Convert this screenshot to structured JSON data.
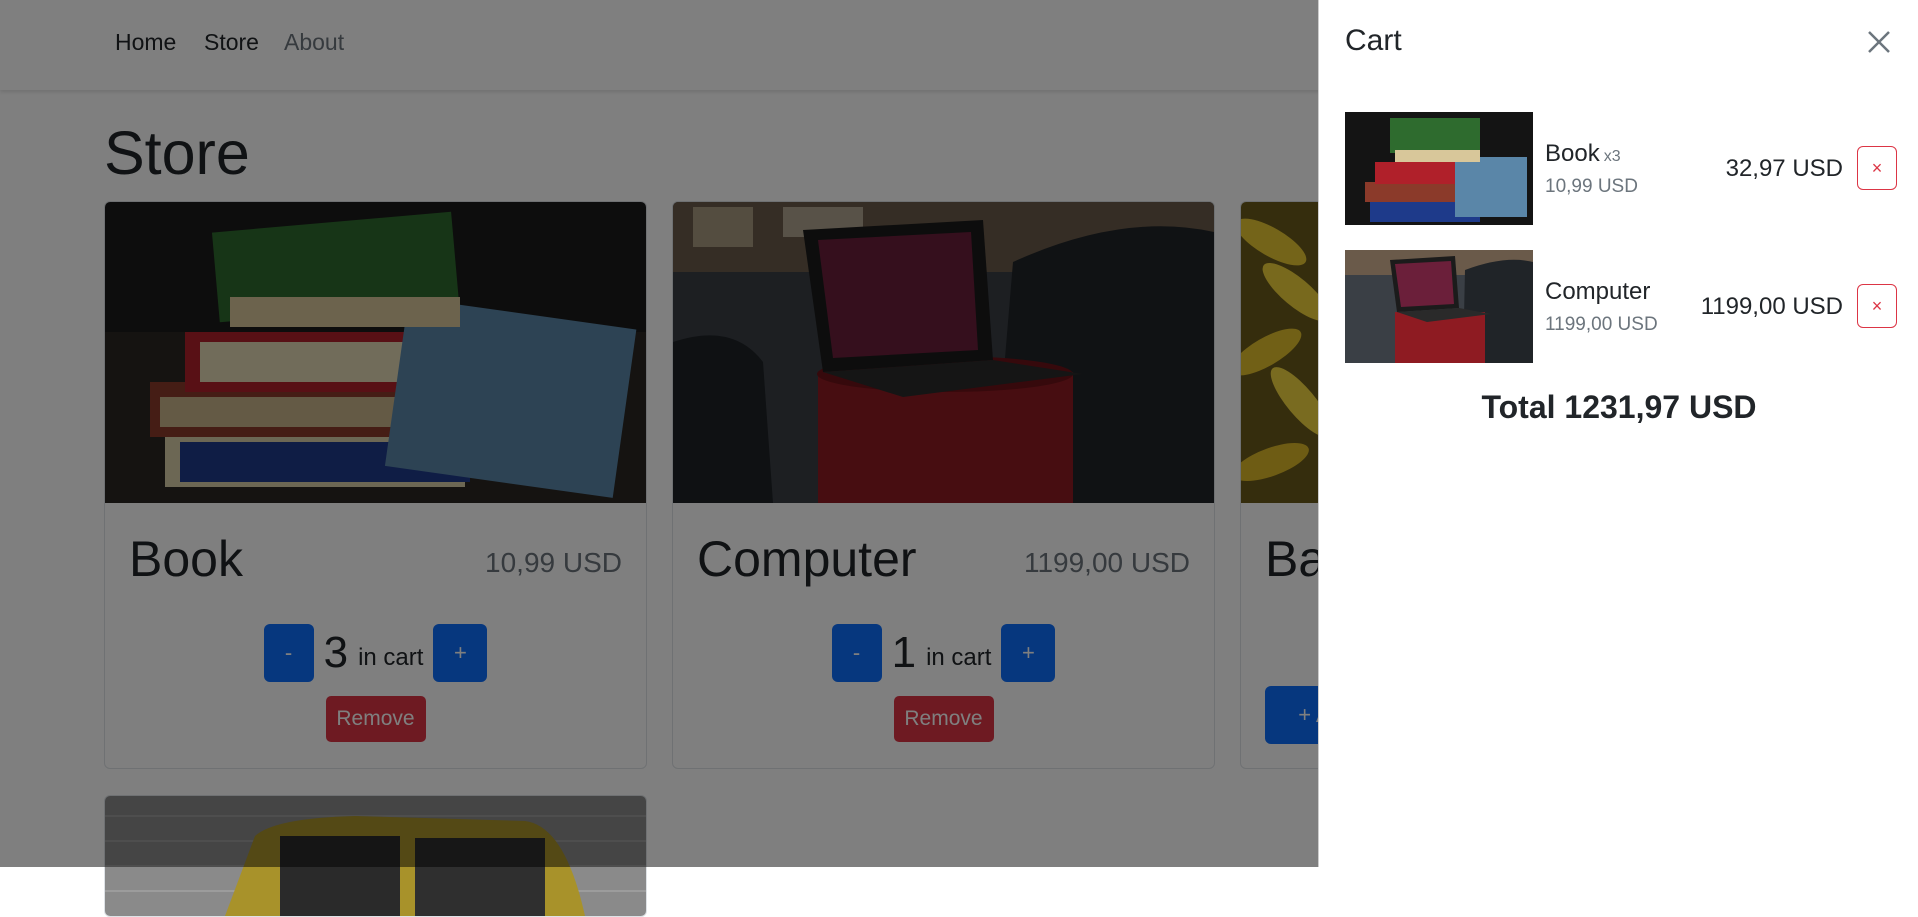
{
  "nav": {
    "links": [
      {
        "label": "Home"
      },
      {
        "label": "Store"
      },
      {
        "label": "About"
      }
    ]
  },
  "page": {
    "title": "Store"
  },
  "products": [
    {
      "name": "Book",
      "price": "10,99 USD",
      "quantity": "3",
      "in_cart_label": "in cart",
      "minus": "-",
      "plus": "+",
      "remove": "Remove"
    },
    {
      "name": "Computer",
      "price": "1199,00 USD",
      "quantity": "1",
      "in_cart_label": "in cart",
      "minus": "-",
      "plus": "+",
      "remove": "Remove"
    },
    {
      "name": "Banana",
      "add_label": "+ Add To Cart"
    }
  ],
  "cart": {
    "title": "Cart",
    "close_icon": "close-icon",
    "items": [
      {
        "name": "Book",
        "quantity": "x3",
        "unit_price": "10,99 USD",
        "line_total": "32,97 USD",
        "remove": "×"
      },
      {
        "name": "Computer",
        "quantity": "",
        "unit_price": "1199,00 USD",
        "line_total": "1199,00 USD",
        "remove": "×"
      }
    ],
    "total": "Total 1231,97 USD"
  },
  "colors": {
    "primary": "#0d6efd",
    "danger": "#dc3545",
    "backdrop": "rgba(0,0,0,0.5)",
    "muted": "#6c757d"
  }
}
